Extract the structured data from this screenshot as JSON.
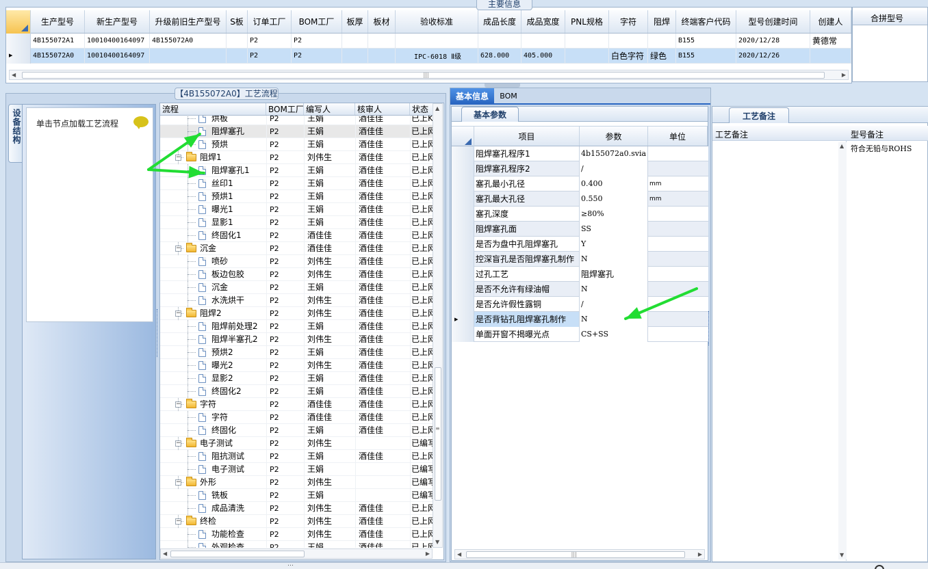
{
  "top_panel": {
    "caption": "主要信息",
    "columns": [
      "生产型号",
      "新生产型号",
      "升级前旧生产型号",
      "S板",
      "订单工厂",
      "BOM工厂",
      "板厚",
      "板材",
      "验收标准",
      "成品长度",
      "成品宽度",
      "PNL规格",
      "字符",
      "阻焊",
      "终端客户代码",
      "型号创建时间",
      "创建人"
    ],
    "rows": [
      {
        "selected": false,
        "cells": [
          "4B155072A1",
          "10010400164097",
          "4B155072A0",
          "",
          "P2",
          "P2",
          "",
          "",
          "",
          "",
          "",
          "",
          "",
          "",
          "B155",
          "2020/12/28",
          "黄德常"
        ]
      },
      {
        "selected": true,
        "cells": [
          "4B155072A0",
          "10010400164097",
          "",
          "",
          "P2",
          "P2",
          "",
          "",
          "IPC-6018 Ⅱ级",
          "628.000",
          "405.000",
          "",
          "白色字符",
          "绿色",
          "B155",
          "2020/12/26",
          ""
        ]
      }
    ],
    "side_header": "合拼型号"
  },
  "process_panel": {
    "caption": "【4B155072A0】工艺流程",
    "side_tab": "设备结构",
    "hint_text": "单击节点加载工艺流程",
    "columns": [
      "流程",
      "BOM工厂",
      "编写人",
      "核审人",
      "状态"
    ],
    "rows": [
      {
        "level": 2,
        "type": "doc",
        "label": "烘板",
        "bom": "P2",
        "writer": "王娟",
        "reviewer": "酒佳佳",
        "status": "已上K"
      },
      {
        "level": 2,
        "type": "doc",
        "label": "阻焊塞孔",
        "bom": "P2",
        "writer": "王娟",
        "reviewer": "酒佳佳",
        "status": "已上网",
        "highlight": true
      },
      {
        "level": 2,
        "type": "doc",
        "label": "预烘",
        "bom": "P2",
        "writer": "王娟",
        "reviewer": "酒佳佳",
        "status": "已上网"
      },
      {
        "level": 1,
        "type": "folder",
        "label": "阻焊1",
        "bom": "P2",
        "writer": "刘伟生",
        "reviewer": "酒佳佳",
        "status": "已上网"
      },
      {
        "level": 2,
        "type": "doc",
        "label": "阻焊塞孔1",
        "bom": "P2",
        "writer": "王娟",
        "reviewer": "酒佳佳",
        "status": "已上网"
      },
      {
        "level": 2,
        "type": "doc",
        "label": "丝印1",
        "bom": "P2",
        "writer": "王娟",
        "reviewer": "酒佳佳",
        "status": "已上网"
      },
      {
        "level": 2,
        "type": "doc",
        "label": "预烘1",
        "bom": "P2",
        "writer": "王娟",
        "reviewer": "酒佳佳",
        "status": "已上网"
      },
      {
        "level": 2,
        "type": "doc",
        "label": "曝光1",
        "bom": "P2",
        "writer": "王娟",
        "reviewer": "酒佳佳",
        "status": "已上网"
      },
      {
        "level": 2,
        "type": "doc",
        "label": "显影1",
        "bom": "P2",
        "writer": "王娟",
        "reviewer": "酒佳佳",
        "status": "已上网"
      },
      {
        "level": 2,
        "type": "doc",
        "label": "终固化1",
        "bom": "P2",
        "writer": "酒佳佳",
        "reviewer": "酒佳佳",
        "status": "已上网"
      },
      {
        "level": 1,
        "type": "folder",
        "label": "沉金",
        "bom": "P2",
        "writer": "酒佳佳",
        "reviewer": "酒佳佳",
        "status": "已上网"
      },
      {
        "level": 2,
        "type": "doc",
        "label": "喷砂",
        "bom": "P2",
        "writer": "刘伟生",
        "reviewer": "酒佳佳",
        "status": "已上网"
      },
      {
        "level": 2,
        "type": "doc",
        "label": "板边包胶",
        "bom": "P2",
        "writer": "刘伟生",
        "reviewer": "酒佳佳",
        "status": "已上网"
      },
      {
        "level": 2,
        "type": "doc",
        "label": "沉金",
        "bom": "P2",
        "writer": "王娟",
        "reviewer": "酒佳佳",
        "status": "已上网"
      },
      {
        "level": 2,
        "type": "doc",
        "label": "水洗烘干",
        "bom": "P2",
        "writer": "刘伟生",
        "reviewer": "酒佳佳",
        "status": "已上网"
      },
      {
        "level": 1,
        "type": "folder",
        "label": "阻焊2",
        "bom": "P2",
        "writer": "刘伟生",
        "reviewer": "酒佳佳",
        "status": "已上网"
      },
      {
        "level": 2,
        "type": "doc",
        "label": "阻焊前处理2",
        "bom": "P2",
        "writer": "王娟",
        "reviewer": "酒佳佳",
        "status": "已上网"
      },
      {
        "level": 2,
        "type": "doc",
        "label": "阻焊半塞孔2",
        "bom": "P2",
        "writer": "刘伟生",
        "reviewer": "酒佳佳",
        "status": "已上网"
      },
      {
        "level": 2,
        "type": "doc",
        "label": "预烘2",
        "bom": "P2",
        "writer": "王娟",
        "reviewer": "酒佳佳",
        "status": "已上网"
      },
      {
        "level": 2,
        "type": "doc",
        "label": "曝光2",
        "bom": "P2",
        "writer": "刘伟生",
        "reviewer": "酒佳佳",
        "status": "已上网"
      },
      {
        "level": 2,
        "type": "doc",
        "label": "显影2",
        "bom": "P2",
        "writer": "王娟",
        "reviewer": "酒佳佳",
        "status": "已上网"
      },
      {
        "level": 2,
        "type": "doc",
        "label": "终固化2",
        "bom": "P2",
        "writer": "王娟",
        "reviewer": "酒佳佳",
        "status": "已上网"
      },
      {
        "level": 1,
        "type": "folder",
        "label": "字符",
        "bom": "P2",
        "writer": "酒佳佳",
        "reviewer": "酒佳佳",
        "status": "已上网"
      },
      {
        "level": 2,
        "type": "doc",
        "label": "字符",
        "bom": "P2",
        "writer": "酒佳佳",
        "reviewer": "酒佳佳",
        "status": "已上网"
      },
      {
        "level": 2,
        "type": "doc",
        "label": "终固化",
        "bom": "P2",
        "writer": "王娟",
        "reviewer": "酒佳佳",
        "status": "已上网"
      },
      {
        "level": 1,
        "type": "folder",
        "label": "电子测试",
        "bom": "P2",
        "writer": "刘伟生",
        "reviewer": "",
        "status": "已编写"
      },
      {
        "level": 2,
        "type": "doc",
        "label": "阻抗测试",
        "bom": "P2",
        "writer": "王娟",
        "reviewer": "酒佳佳",
        "status": "已上网"
      },
      {
        "level": 2,
        "type": "doc",
        "label": "电子测试",
        "bom": "P2",
        "writer": "王娟",
        "reviewer": "",
        "status": "已编写"
      },
      {
        "level": 1,
        "type": "folder",
        "label": "外形",
        "bom": "P2",
        "writer": "刘伟生",
        "reviewer": "",
        "status": "已编写"
      },
      {
        "level": 2,
        "type": "doc",
        "label": "铣板",
        "bom": "P2",
        "writer": "王娟",
        "reviewer": "",
        "status": "已编写"
      },
      {
        "level": 2,
        "type": "doc",
        "label": "成品清洗",
        "bom": "P2",
        "writer": "刘伟生",
        "reviewer": "酒佳佳",
        "status": "已上网"
      },
      {
        "level": 1,
        "type": "folder",
        "label": "终检",
        "bom": "P2",
        "writer": "刘伟生",
        "reviewer": "酒佳佳",
        "status": "已上网"
      },
      {
        "level": 2,
        "type": "doc",
        "label": "功能检查",
        "bom": "P2",
        "writer": "刘伟生",
        "reviewer": "酒佳佳",
        "status": "已上网"
      },
      {
        "level": 2,
        "type": "doc",
        "label": "外观检查",
        "bom": "P2",
        "writer": "王娟",
        "reviewer": "酒佳佳",
        "status": "已上网"
      }
    ]
  },
  "info_panel": {
    "tabs": [
      "基本信息",
      "BOM"
    ],
    "subtab": "基本参数",
    "columns": [
      "项目",
      "参数",
      "单位"
    ],
    "rows": [
      {
        "item": "阻焊塞孔程序1",
        "value": "4b155072a0.svia",
        "unit": ""
      },
      {
        "item": "阻焊塞孔程序2",
        "value": "/",
        "unit": ""
      },
      {
        "item": "塞孔最小孔径",
        "value": "0.400",
        "unit": "mm"
      },
      {
        "item": "塞孔最大孔径",
        "value": "0.550",
        "unit": "mm"
      },
      {
        "item": "塞孔深度",
        "value": "≥80%",
        "unit": ""
      },
      {
        "item": "阻焊塞孔面",
        "value": "SS",
        "unit": ""
      },
      {
        "item": "是否为盘中孔阻焊塞孔",
        "value": "Y",
        "unit": ""
      },
      {
        "item": "控深盲孔是否阻焊塞孔制作",
        "value": "N",
        "unit": ""
      },
      {
        "item": "过孔工艺",
        "value": "阻焊塞孔",
        "unit": ""
      },
      {
        "item": "是否不允许有绿油帽",
        "value": "N",
        "unit": ""
      },
      {
        "item": "是否允许假性露铜",
        "value": "/",
        "unit": ""
      },
      {
        "item": "是否背钻孔阻焊塞孔制作",
        "value": "N",
        "unit": "",
        "selected": true
      },
      {
        "item": "单面开窗不揭曝光点",
        "value": "CS+SS",
        "unit": ""
      }
    ]
  },
  "notes_panel": {
    "subtab": "工艺备注",
    "columns": [
      "工艺备注",
      "型号备注"
    ],
    "model_note": "符合无铅与ROHS"
  },
  "status_bar": {
    "text": "…"
  },
  "colors": {
    "accent": "#3a7ad5",
    "selected_row": "#c7dff7",
    "annotation_arrow": "#22dd33"
  }
}
